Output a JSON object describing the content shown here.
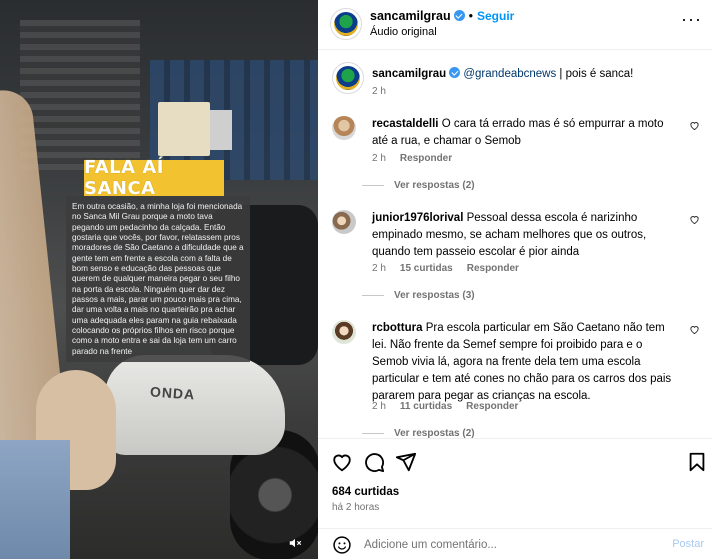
{
  "media": {
    "banner": "FALA AÍ SANCA",
    "caption": "Em outra ocasião, a minha loja foi mencionada no Sanca Mil Grau porque a moto tava pegando um pedacinho da calçada. Então gostaria que vocês, por favor, relatassem pros moradores de São Caetano a dificuldade que a gente tem em frente a escola com a falta de bom senso e educação das pessoas que querem de qualquer maneira pegar o seu filho na porta da escola. Ninguém quer dar dez passos a mais, parar um pouco mais pra cima, dar uma volta a mais no quarteirão pra achar uma adequada eles param na guia rebaixada colocando os próprios filhos em risco porque como a moto entra e sai da loja tem um carro parado na frente",
    "moto_brand": "ONDA",
    "mute_icon": "speaker-muted-icon"
  },
  "header": {
    "username": "sancamilgrau",
    "separator": "•",
    "follow_label": "Seguir",
    "audio": "Áudio original",
    "more_icon": "ellipsis-icon",
    "more_label": "···"
  },
  "caption_post": {
    "username": "sancamilgrau",
    "mention": "@grandeabcnews",
    "text": " | pois é sanca!",
    "time": "2 h"
  },
  "comments": [
    {
      "username": "recastaldelli",
      "text": "O cara tá errado mas é só empurrar a moto até a rua, e chamar o Semob",
      "time": "2 h",
      "likes": "",
      "reply": "Responder",
      "view_replies": "Ver respostas (2)"
    },
    {
      "username": "junior1976lorival",
      "text": "Pessoal dessa escola é narizinho empinado mesmo, se acham melhores que os outros, quando tem passeio escolar é pior ainda",
      "time": "2 h",
      "likes": "15 curtidas",
      "reply": "Responder",
      "view_replies": "Ver respostas (3)"
    },
    {
      "username": "rcbottura",
      "text": "Pra escola particular em São Caetano não tem lei. Não frente da Semef sempre foi proibido para e o Semob vivia lá, agora na frente dela tem uma escola particular e tem até cones no chão para os carros dos pais pararem para pegar as crianças na escola.",
      "time": "2 h",
      "likes": "11 curtidas",
      "reply": "Responder",
      "view_replies": "Ver respostas (2)"
    }
  ],
  "actions": {
    "likes": "684 curtidas",
    "time_ago": "há 2 horas"
  },
  "compose": {
    "placeholder": "Adicione um comentário...",
    "post_label": "Postar"
  },
  "colors": {
    "accent": "#0095f6",
    "verified": "#3897f0",
    "banner": "#f2c230",
    "muted_text": "#737373"
  }
}
